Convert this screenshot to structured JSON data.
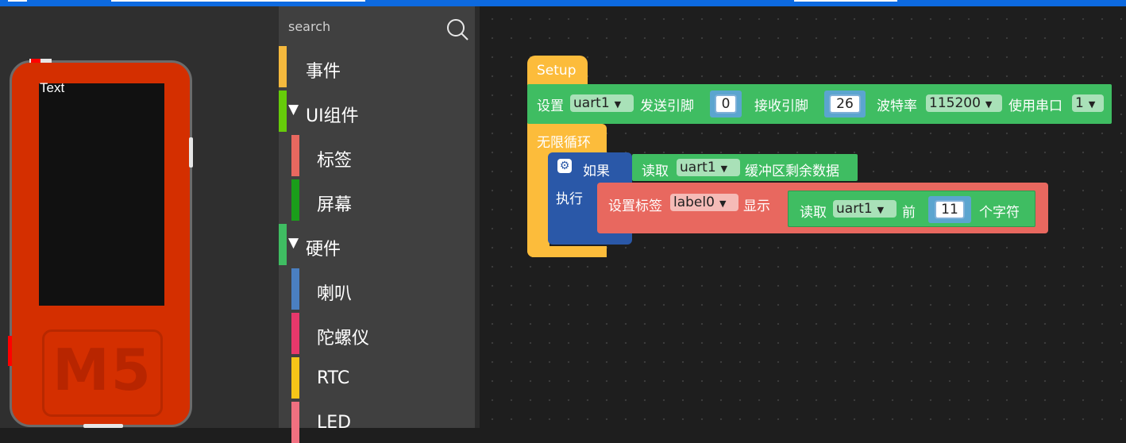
{
  "colors": {
    "setup": "#fcbc3b",
    "uart": "#3fbd62",
    "if": "#2a58a8",
    "label": "#e8685f",
    "math": "#5ba5cf",
    "device": "#d42f00"
  },
  "device": {
    "screen_text": "Text",
    "logo": "M5"
  },
  "search": {
    "placeholder": "search",
    "icon": "search-icon"
  },
  "categories": [
    {
      "label": "事件",
      "color": "#f5b93d"
    },
    {
      "label": "UI组件",
      "color": "#66cc0a",
      "expanded": true
    },
    {
      "label": "标签",
      "color": "#e8685f"
    },
    {
      "label": "屏幕",
      "color": "#1a9e1a"
    },
    {
      "label": "硬件",
      "color": "#3fbd62",
      "expanded": true
    },
    {
      "label": "喇叭",
      "color": "#4a7fc1"
    },
    {
      "label": "陀螺仪",
      "color": "#e8386b"
    },
    {
      "label": "RTC",
      "color": "#f5c518"
    },
    {
      "label": "LED",
      "color": "#f07080"
    }
  ],
  "blocks": {
    "setup": {
      "title": "Setup",
      "uart": {
        "set_label": "设置",
        "port": "uart1",
        "tx_label": "发送引脚",
        "tx_pin": "0",
        "rx_label": "接收引脚",
        "rx_pin": "26",
        "baud_label": "波特率",
        "baud": "115200",
        "serial_label": "使用串口",
        "serial": "1"
      }
    },
    "loop": {
      "title": "无限循环",
      "if_label": "如果",
      "do_label": "执行",
      "read_label": "读取",
      "read_port": "uart1",
      "buffer_label": "缓冲区剩余数据",
      "set_label_text": "设置标签",
      "label_name": "label0",
      "show_label": "显示",
      "read2_label": "读取",
      "read2_port": "uart1",
      "front_label": "前",
      "count": "11",
      "chars_label": "个字符"
    }
  }
}
